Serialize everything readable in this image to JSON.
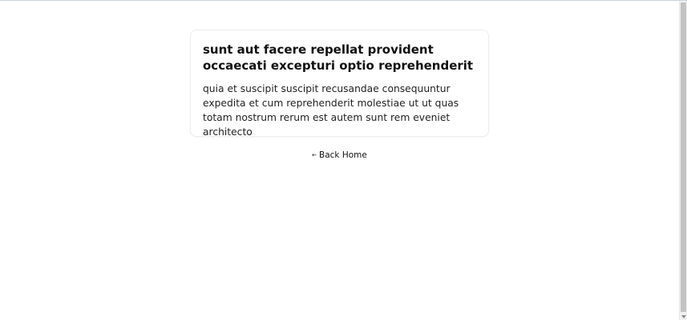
{
  "post": {
    "title": "sunt aut facere repellat provident occaecati excepturi optio reprehenderit",
    "body": "quia et suscipit suscipit recusandae consequuntur expedita et cum reprehenderit molestiae ut ut quas totam nostrum rerum est autem sunt rem eveniet architecto"
  },
  "nav": {
    "back_arrow": "←",
    "back_label": "Back Home"
  },
  "icons": {
    "back": "arrow-left-icon",
    "scroll_down": "chevron-down-icon"
  }
}
